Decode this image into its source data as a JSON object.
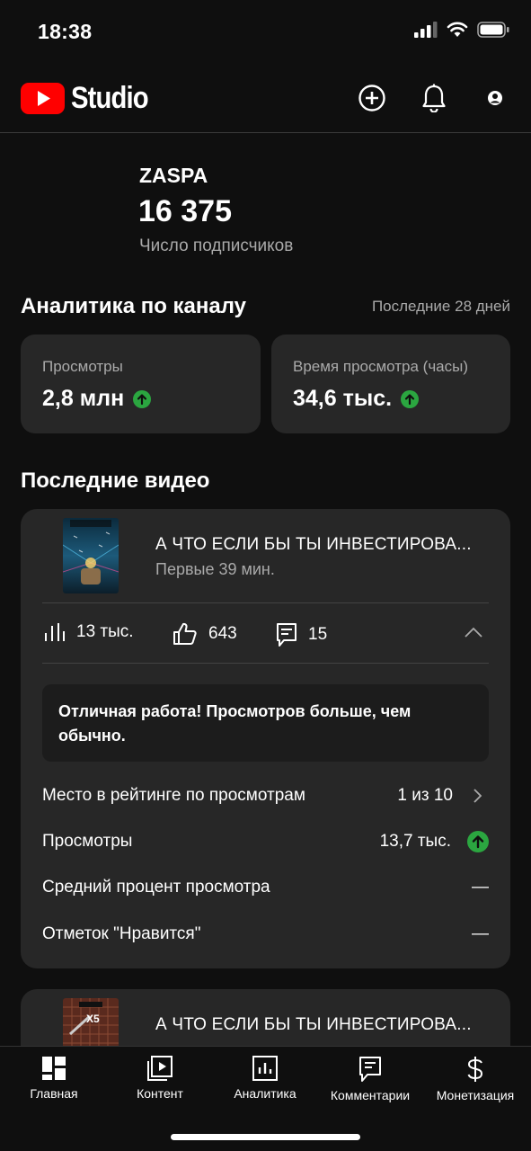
{
  "status_bar": {
    "time": "18:38"
  },
  "header": {
    "logo_text": "Studio"
  },
  "channel": {
    "name": "ZASPA",
    "subscribers": "16 375",
    "subscribers_label": "Число подписчиков"
  },
  "analytics": {
    "title": "Аналитика по каналу",
    "period": "Последние 28 дней",
    "cards": [
      {
        "label": "Просмотры",
        "value": "2,8 млн",
        "trend": "up"
      },
      {
        "label": "Время просмотра (часы)",
        "value": "34,6 тыс.",
        "trend": "up"
      }
    ]
  },
  "recent": {
    "title": "Последние видео",
    "videos": [
      {
        "title": "А ЧТО ЕСЛИ БЫ ТЫ ИНВЕСТИРОВА...",
        "subtitle": "Первые 39 мин.",
        "views": "13 тыс.",
        "likes": "643",
        "comments": "15",
        "note": "Отличная работа! Просмотров больше, чем обычно.",
        "rows": [
          {
            "label": "Место в рейтинге по просмотрам",
            "value": "1 из 10"
          },
          {
            "label": "Просмотры",
            "value": "13,7 тыс."
          },
          {
            "label": "Средний процент просмотра",
            "value": "—"
          },
          {
            "label": "Отметок \"Нравится\"",
            "value": "—"
          }
        ]
      },
      {
        "title": "А ЧТО ЕСЛИ БЫ ТЫ ИНВЕСТИРОВА...",
        "thumb_text": "Х5"
      }
    ]
  },
  "bottom_nav": [
    {
      "label": "Главная",
      "icon": "dashboard-icon"
    },
    {
      "label": "Контент",
      "icon": "content-icon"
    },
    {
      "label": "Аналитика",
      "icon": "analytics-icon"
    },
    {
      "label": "Комментарии",
      "icon": "comments-icon"
    },
    {
      "label": "Монетизация",
      "icon": "dollar-icon"
    }
  ],
  "colors": {
    "accent_green": "#2ba640",
    "brand_red": "#ff0000",
    "card_bg": "#272727"
  }
}
